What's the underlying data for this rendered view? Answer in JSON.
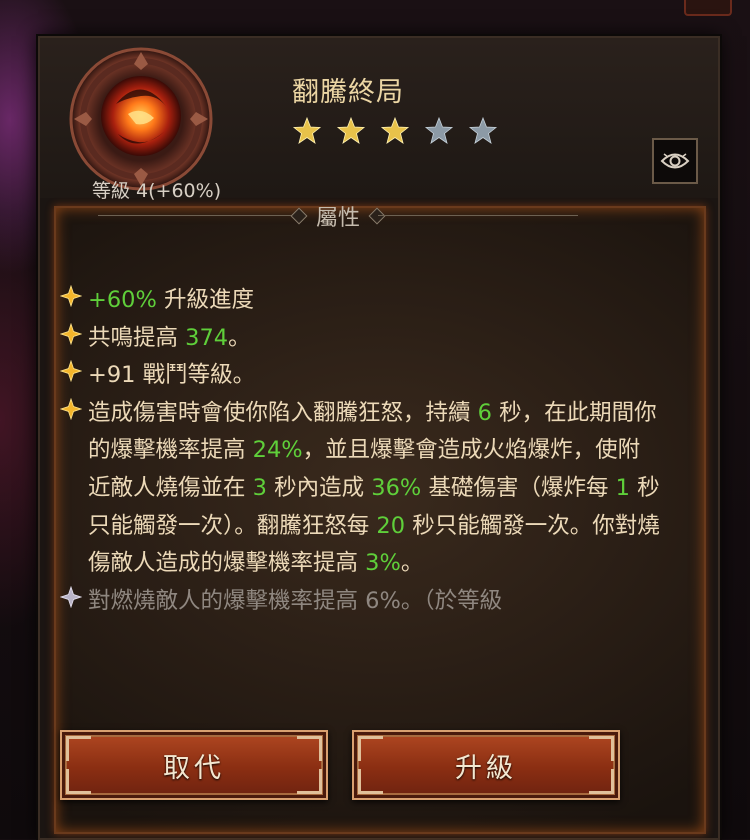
{
  "gem": {
    "name": "翻騰終局",
    "level_label": "等級 4(+60%)",
    "stars_filled": 3,
    "stars_total": 5
  },
  "section": {
    "title": "屬性"
  },
  "properties": [
    {
      "parts": [
        {
          "t": "+60%",
          "c": "g"
        },
        {
          "t": " 升級進度"
        }
      ]
    },
    {
      "parts": [
        {
          "t": "共鳴提高 "
        },
        {
          "t": "374",
          "c": "g"
        },
        {
          "t": "。"
        }
      ]
    },
    {
      "parts": [
        {
          "t": "+91 戰鬥等級。"
        }
      ]
    },
    {
      "parts": [
        {
          "t": "造成傷害時會使你陷入翻騰狂怒，持續 "
        },
        {
          "t": "6",
          "c": "g"
        },
        {
          "t": " 秒，在此期間你的爆擊機率提高 "
        },
        {
          "t": "24%",
          "c": "g"
        },
        {
          "t": "，並且爆擊會造成火焰爆炸，使附近敵人燒傷並在 "
        },
        {
          "t": "3",
          "c": "g"
        },
        {
          "t": " 秒內造成 "
        },
        {
          "t": "36%",
          "c": "g"
        },
        {
          "t": " 基礎傷害（爆炸每 "
        },
        {
          "t": "1",
          "c": "g"
        },
        {
          "t": " 秒只能觸發一次）。翻騰狂怒每 "
        },
        {
          "t": "20",
          "c": "g"
        },
        {
          "t": " 秒只能觸發一次。你對燒傷敵人造成的爆擊機率提高 "
        },
        {
          "t": "3%",
          "c": "g"
        },
        {
          "t": "。"
        }
      ]
    },
    {
      "dim": true,
      "parts": [
        {
          "t": "對燃燒敵人的爆擊機率提高 6%。（於等級"
        }
      ]
    }
  ],
  "buttons": {
    "replace": "取代",
    "upgrade": "升級"
  },
  "colors": {
    "accent_green": "#5fcf3a",
    "gold_star": "#e8c24a",
    "empty_star": "#8c9aa6",
    "text_main": "#ecd9b8",
    "button_red": "#a13a18"
  },
  "icons": {
    "eye": "eye-icon",
    "bullet": "diamond-bullet-icon",
    "gem": "gem-emblem-icon"
  }
}
